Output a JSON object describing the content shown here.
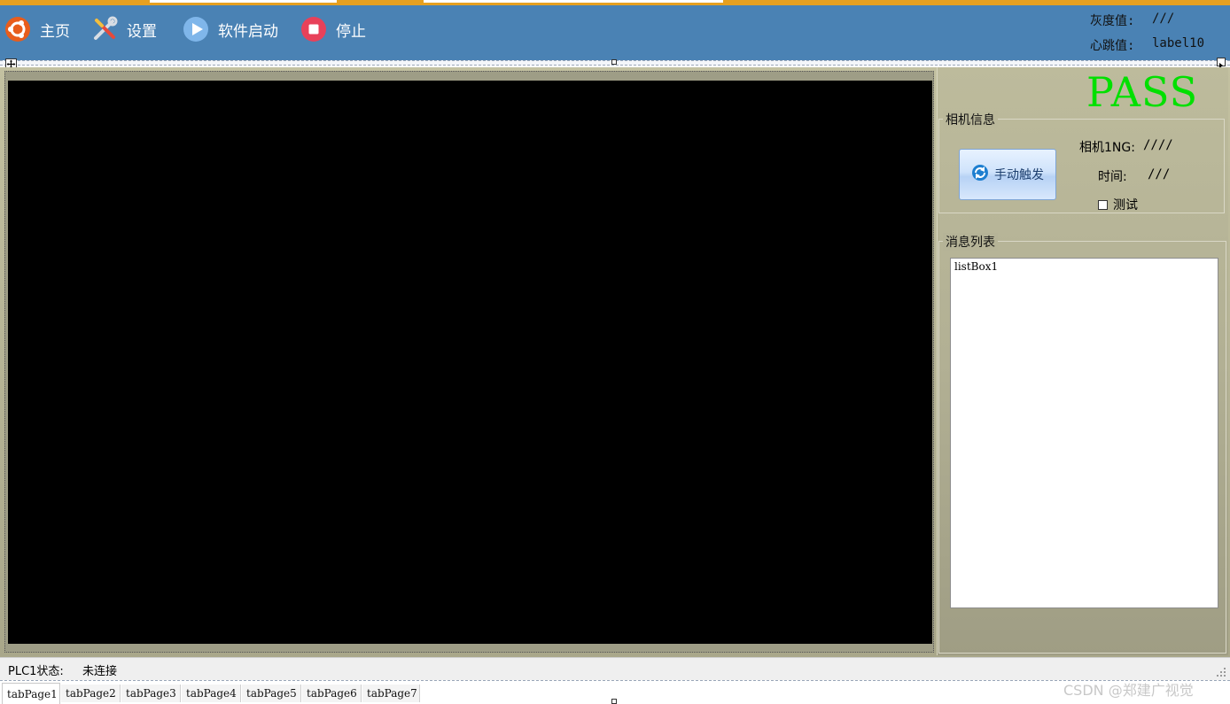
{
  "toolbar": {
    "home_label": "主页",
    "settings_label": "设置",
    "start_label": "软件启动",
    "stop_label": "停止"
  },
  "stats": {
    "gray_label": "灰度值:",
    "gray_value": "///",
    "heartbeat_label": "心跳值:",
    "heartbeat_value": "label10"
  },
  "result": {
    "text": "PASS",
    "color": "#00e000"
  },
  "camera_group": {
    "title": "相机信息",
    "trigger_label": "手动触发",
    "ng_label": "相机1NG:",
    "ng_value": "////",
    "time_label": "时间:",
    "time_value": "///",
    "test_checkbox_label": "测试",
    "test_checked": false
  },
  "message_group": {
    "title": "消息列表",
    "items": [
      "listBox1"
    ]
  },
  "status": {
    "plc_label": "PLC1状态:",
    "plc_value": "未连接"
  },
  "tabs": [
    "tabPage1",
    "tabPage2",
    "tabPage3",
    "tabPage4",
    "tabPage5",
    "tabPage6",
    "tabPage7"
  ],
  "watermark": "CSDN @郑建广视觉",
  "colors": {
    "toolbar": "#4a82b4",
    "accent_strip": "#e6a020",
    "panel": "#b2b094",
    "viewer": "#000000"
  }
}
